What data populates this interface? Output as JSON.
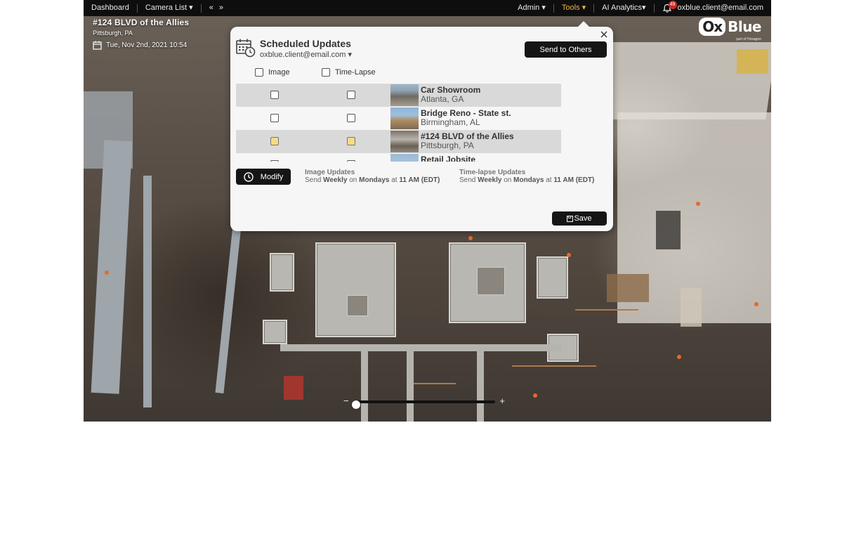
{
  "nav": {
    "dashboard": "Dashboard",
    "camera_list": "Camera List ▾",
    "prev": "«",
    "next": "»",
    "admin": "Admin ▾",
    "tools": "Tools ▾",
    "ai_analytics": "AI Analytics▾",
    "notification_count": "49",
    "user_email": "oxblue.client@email.com"
  },
  "camera": {
    "title": "#124 BLVD of the Allies",
    "location": "Pittsburgh, PA",
    "datetime": "Tue, Nov 2nd, 2021 10:54"
  },
  "logo": {
    "ox": "Ox",
    "blue": "Blue",
    "tagline": "part of Hexagon"
  },
  "timeline": {
    "minus": "−",
    "plus": "+",
    "position": 0.02
  },
  "modal": {
    "title": "Scheduled Updates",
    "email": "oxblue.client@email.com ▾",
    "send_to_others": "Send to Others",
    "col_image": "Image",
    "col_timelapse": "Time-Lapse",
    "rows": [
      {
        "name": "Car Showroom",
        "location": "Atlanta, GA",
        "image": false,
        "timelapse": false,
        "shade": true
      },
      {
        "name": "Bridge Reno - State st.",
        "location": "Birmingham, AL",
        "image": false,
        "timelapse": false,
        "shade": false
      },
      {
        "name": "#124 BLVD of the Allies",
        "location": "Pittsburgh, PA",
        "image": true,
        "timelapse": true,
        "shade": true
      },
      {
        "name": "Retail Jobsite",
        "location": "",
        "image": false,
        "timelapse": false,
        "shade": false
      }
    ],
    "modify": "Modify",
    "image_updates": {
      "heading": "Image Updates",
      "send": "Send",
      "freq": "Weekly",
      "on": "on",
      "day": "Mondays",
      "at": "at",
      "time": "11 AM",
      "tz": "(EDT)"
    },
    "timelapse_updates": {
      "heading": "Time-lapse Updates",
      "send": "Send",
      "freq": "Weekly",
      "on": "on",
      "day": "Mondays",
      "at": "at",
      "time": "11 AM",
      "tz": "(EDT)"
    },
    "save": "Save"
  }
}
